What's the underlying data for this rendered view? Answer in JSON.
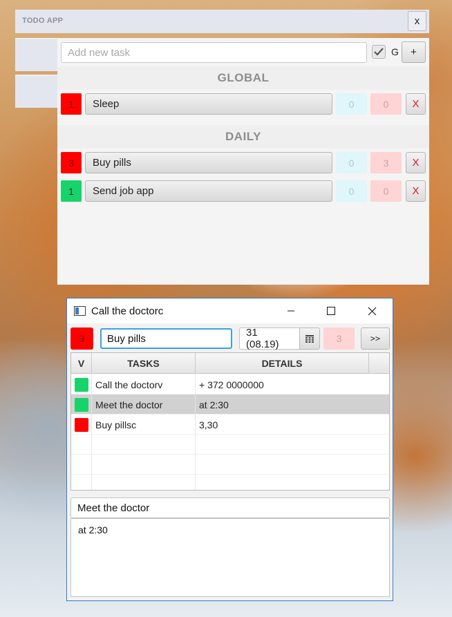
{
  "todo_app": {
    "title": "TODO APP",
    "close_label": "x",
    "new_task_placeholder": "Add new task",
    "global_toggle_label": "G",
    "add_label": "+",
    "sections": [
      {
        "title": "GLOBAL",
        "tasks": [
          {
            "priority": "1",
            "priority_color": "#ff0000",
            "name": "Sleep",
            "count_a": "0",
            "count_b": "0",
            "delete_label": "X"
          }
        ]
      },
      {
        "title": "DAILY",
        "tasks": [
          {
            "priority": "3",
            "priority_color": "#ff0000",
            "name": "Buy pills",
            "count_a": "0",
            "count_b": "3",
            "delete_label": "X"
          },
          {
            "priority": "1",
            "priority_color": "#17d46a",
            "name": "Send job app",
            "count_a": "0",
            "count_b": "0",
            "delete_label": "X"
          }
        ]
      }
    ]
  },
  "dialog": {
    "title": "Call the doctorc",
    "toolbar": {
      "priority": "3",
      "task_name": "Buy pills",
      "date": "31 (08.19)",
      "count": "3",
      "next_label": ">>"
    },
    "table": {
      "headers": [
        "V",
        "TASKS",
        "DETAILS"
      ],
      "rows": [
        {
          "status_color": "#17d46a",
          "task": "Call the doctorv",
          "details": "+ 372 0000000"
        },
        {
          "status_color": "#17d46a",
          "task": "Meet the doctor",
          "details": "at 2:30"
        },
        {
          "status_color": "#ff0000",
          "task": "Buy pillsc",
          "details": "3,30"
        }
      ],
      "selected_row": 1
    },
    "detail": {
      "title": "Meet the doctor",
      "body": "at 2:30"
    }
  }
}
